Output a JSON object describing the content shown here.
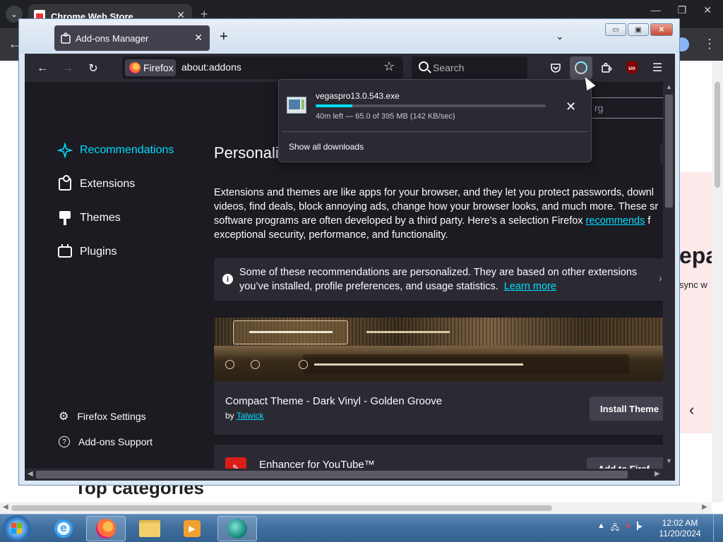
{
  "chrome_bg": {
    "tab_title": "Chrome Web Store",
    "side_heading": "epa",
    "side_sub": "sync w",
    "bottom_heading": "Top categories"
  },
  "firefox": {
    "tab_title": "Add-ons Manager",
    "identity_label": "Firefox",
    "url": "about:addons",
    "search_placeholder": "Search",
    "find_placeholder": "rg"
  },
  "sidebar": {
    "categories": [
      {
        "label": "Recommendations",
        "active": true
      },
      {
        "label": "Extensions"
      },
      {
        "label": "Themes"
      },
      {
        "label": "Plugins"
      }
    ],
    "footer": [
      {
        "label": "Firefox Settings"
      },
      {
        "label": "Add-ons Support"
      }
    ]
  },
  "main": {
    "title": "Personaliz",
    "intro_line1": "Extensions and themes are like apps for your browser, and they let you protect passwords, downl",
    "intro_line2": "videos, find deals, block annoying ads, change how your browser looks, and much more. These sr",
    "intro_line3_pre": "software programs are often developed by a third party. Here’s a selection Firefox ",
    "intro_link": "recommends",
    "intro_line3_post": " f",
    "intro_line4": "exceptional security, performance, and functionality.",
    "notice_line1": "Some of these recommendations are personalized. They are based on other extensions",
    "notice_line2": "you’ve installed, profile preferences, and usage statistics.",
    "notice_link": "Learn more",
    "theme_card": {
      "name": "Compact Theme - Dark Vinyl - Golden Groove",
      "by_label": "by",
      "author": "Talwick",
      "button": "Install Theme"
    },
    "ext_card": {
      "name": "Enhancer for YouTube™",
      "button": "Add to Firef"
    }
  },
  "downloads": {
    "file_name": "vegaspro13.0.543.exe",
    "progress": 0.16,
    "status": "40m left — 65.0 of 395 MB (142 KB/sec)",
    "show_all": "Show all downloads"
  },
  "taskbar": {
    "time": "12:02 AM",
    "date": "11/20/2024"
  },
  "colors": {
    "accent": "#00ddff",
    "ff_bg": "#1c1b22",
    "ff_card": "#2b2a33"
  }
}
